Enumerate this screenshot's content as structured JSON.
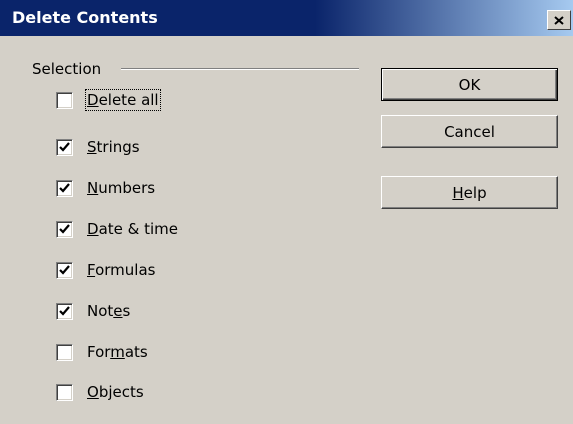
{
  "window": {
    "title": "Delete Contents",
    "close_icon": "close-icon"
  },
  "selection": {
    "label": "Selection",
    "options": [
      {
        "key": "delete_all",
        "pre": "",
        "mn": "D",
        "post": "elete all",
        "checked": false
      },
      {
        "key": "strings",
        "pre": "",
        "mn": "S",
        "post": "trings",
        "checked": true
      },
      {
        "key": "numbers",
        "pre": "",
        "mn": "N",
        "post": "umbers",
        "checked": true
      },
      {
        "key": "date_time",
        "pre": "",
        "mn": "D",
        "post": "ate & time",
        "checked": true
      },
      {
        "key": "formulas",
        "pre": "",
        "mn": "F",
        "post": "ormulas",
        "checked": true
      },
      {
        "key": "notes",
        "pre": "Not",
        "mn": "e",
        "post": "s",
        "checked": true
      },
      {
        "key": "formats",
        "pre": "For",
        "mn": "m",
        "post": "ats",
        "checked": false
      },
      {
        "key": "objects",
        "pre": "",
        "mn": "O",
        "post": "bjects",
        "checked": false
      }
    ]
  },
  "buttons": {
    "ok": {
      "pre": "OK",
      "mn": "",
      "post": ""
    },
    "cancel": {
      "pre": "Cancel",
      "mn": "",
      "post": ""
    },
    "help": {
      "pre": "",
      "mn": "H",
      "post": "elp"
    }
  }
}
